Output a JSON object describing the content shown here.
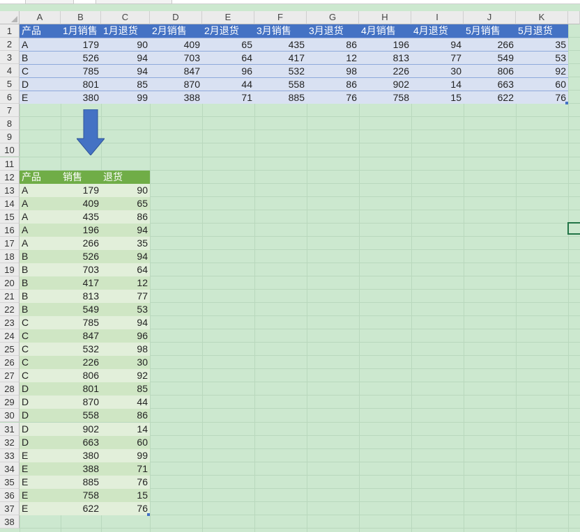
{
  "columns": [
    "A",
    "B",
    "C",
    "D",
    "E",
    "F",
    "G",
    "H",
    "I",
    "J",
    "K"
  ],
  "row_numbers": [
    "1",
    "2",
    "3",
    "4",
    "5",
    "6",
    "7",
    "8",
    "9",
    "10",
    "11",
    "12",
    "13",
    "14",
    "15",
    "16",
    "17",
    "18",
    "19",
    "20",
    "21",
    "22",
    "23",
    "24",
    "25",
    "26",
    "27",
    "28",
    "29",
    "30",
    "31",
    "32",
    "33",
    "34",
    "35",
    "36",
    "37",
    "38"
  ],
  "top_table": {
    "headers": [
      "产品",
      "1月销售",
      "1月退货",
      "2月销售",
      "2月退货",
      "3月销售",
      "3月退货",
      "4月销售",
      "4月退货",
      "5月销售",
      "5月退货"
    ],
    "rows": [
      [
        "A",
        "179",
        "90",
        "409",
        "65",
        "435",
        "86",
        "196",
        "94",
        "266",
        "35"
      ],
      [
        "B",
        "526",
        "94",
        "703",
        "64",
        "417",
        "12",
        "813",
        "77",
        "549",
        "53"
      ],
      [
        "C",
        "785",
        "94",
        "847",
        "96",
        "532",
        "98",
        "226",
        "30",
        "806",
        "92"
      ],
      [
        "D",
        "801",
        "85",
        "870",
        "44",
        "558",
        "86",
        "902",
        "14",
        "663",
        "60"
      ],
      [
        "E",
        "380",
        "99",
        "388",
        "71",
        "885",
        "76",
        "758",
        "15",
        "622",
        "76"
      ]
    ]
  },
  "bottom_table": {
    "headers": [
      "产品",
      "销售",
      "退货"
    ],
    "rows": [
      [
        "A",
        "179",
        "90"
      ],
      [
        "A",
        "409",
        "65"
      ],
      [
        "A",
        "435",
        "86"
      ],
      [
        "A",
        "196",
        "94"
      ],
      [
        "A",
        "266",
        "35"
      ],
      [
        "B",
        "526",
        "94"
      ],
      [
        "B",
        "703",
        "64"
      ],
      [
        "B",
        "417",
        "12"
      ],
      [
        "B",
        "813",
        "77"
      ],
      [
        "B",
        "549",
        "53"
      ],
      [
        "C",
        "785",
        "94"
      ],
      [
        "C",
        "847",
        "96"
      ],
      [
        "C",
        "532",
        "98"
      ],
      [
        "C",
        "226",
        "30"
      ],
      [
        "C",
        "806",
        "92"
      ],
      [
        "D",
        "801",
        "85"
      ],
      [
        "D",
        "870",
        "44"
      ],
      [
        "D",
        "558",
        "86"
      ],
      [
        "D",
        "902",
        "14"
      ],
      [
        "D",
        "663",
        "60"
      ],
      [
        "E",
        "380",
        "99"
      ],
      [
        "E",
        "388",
        "71"
      ],
      [
        "E",
        "885",
        "76"
      ],
      [
        "E",
        "758",
        "15"
      ],
      [
        "E",
        "622",
        "76"
      ]
    ]
  },
  "colors": {
    "header_blue": "#4472c4",
    "band_blue": "#d9e1f2",
    "header_green": "#70ad47",
    "sheet_bg": "#cce8cf",
    "arrow": "#4472c4"
  },
  "icons": {
    "arrow": "down-arrow-icon"
  }
}
